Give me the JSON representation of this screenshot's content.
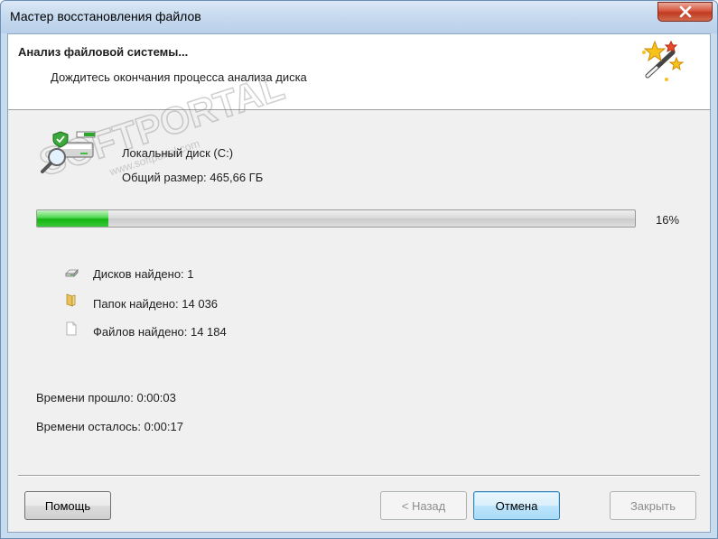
{
  "window": {
    "title": "Мастер восстановления файлов"
  },
  "header": {
    "title": "Анализ файловой системы...",
    "subtitle": "Дождитесь окончания процесса анализа диска"
  },
  "disk": {
    "name": "Локальный диск (C:)",
    "size": "Общий размер: 465,66 ГБ"
  },
  "progress": {
    "value": 0.12,
    "label": "16%"
  },
  "stats": {
    "disks": "Дисков найдено: 1",
    "folders": "Папок найдено: 14 036",
    "files": "Файлов найдено: 14 184"
  },
  "time": {
    "elapsed": "Времени прошло: 0:00:03",
    "remaining": "Времени осталось: 0:00:17"
  },
  "buttons": {
    "help": "Помощь",
    "back": "< Назад",
    "cancel": "Отмена",
    "close": "Закрыть"
  },
  "watermark": {
    "brand": "SOFTPORTAL",
    "url": "www.softportal.com",
    "tm": "TM"
  },
  "colors": {
    "accent": "#3c7fb1",
    "progress": "#15b515"
  },
  "icons": {
    "close": "close-icon",
    "wand": "magic-wand-icon",
    "disk": "disk-scan-icon",
    "drive": "drive-icon",
    "folder": "folder-icon",
    "file": "file-icon"
  }
}
